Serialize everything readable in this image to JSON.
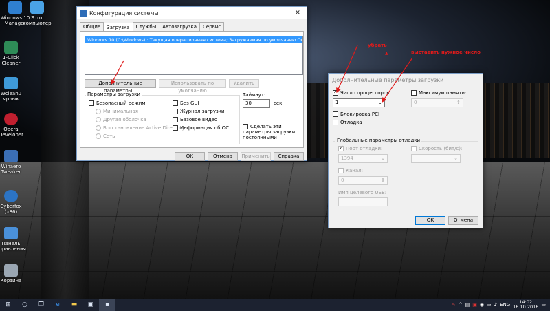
{
  "desktop_icons": [
    {
      "label_line1": "Windows 10",
      "label_line2": "Manager",
      "color": "#2f7fd0"
    },
    {
      "label_line1": "Этот",
      "label_line2": "компьютер",
      "color": "#4aa3e6"
    },
    {
      "label_line1": "1-Click",
      "label_line2": "Cleaner",
      "color": "#2e8b57"
    },
    {
      "label_line1": "Wcleanu",
      "label_line2": "ярлык",
      "color": "#3f9ad8"
    },
    {
      "label_line1": "Opera",
      "label_line2": "Developer",
      "color": "#c01f2f"
    },
    {
      "label_line1": "Winaero",
      "label_line2": "Tweaker",
      "color": "#3b6fb6"
    },
    {
      "label_line1": "Cyberfox",
      "label_line2": "(x86)",
      "color": "#2c74c5"
    },
    {
      "label_line1": "Панель",
      "label_line2": "управления",
      "color": "#4a90d9"
    },
    {
      "label_line1": "Корзина",
      "label_line2": "",
      "color": "#9aa6b2"
    }
  ],
  "msconfig": {
    "title": "Конфигурация системы",
    "close": "✕",
    "tabs": [
      "Общие",
      "Загрузка",
      "Службы",
      "Автозагрузка",
      "Сервис"
    ],
    "active_tab": "Загрузка",
    "boot_entry": "Windows 10 (C:\\Windows) : Текущая операционная система; Загружаемая по умолчанию ОС",
    "advanced_button": "Дополнительные параметры...",
    "set_default_button": "Использовать по умолчанию",
    "delete_button": "Удалить",
    "boot_options_label": "Параметры загрузки",
    "safe_mode": "Безопасный режим",
    "minimal": "Минимальная",
    "alt_shell": "Другая оболочка",
    "ad_restore": "Восстановление Active Directory",
    "network": "Сеть",
    "no_gui": "Без GUI",
    "boot_log": "Журнал загрузки",
    "base_video": "Базовое видео",
    "os_info": "Информация об ОС",
    "timeout_label": "Таймаут:",
    "timeout_value": "30",
    "timeout_unit": "сек.",
    "make_permanent": "Сделать эти параметры загрузки постоянными",
    "ok": "ОК",
    "cancel": "Отмена",
    "apply": "Применить",
    "help": "Справка"
  },
  "advanced": {
    "title": "Дополнительные параметры загрузки",
    "num_processors_label": "Число процессоров:",
    "num_processors_value": "1",
    "max_memory_label": "Максимум памяти:",
    "max_memory_value": "0",
    "pci_lock": "Блокировка PCI",
    "debug": "Отладка",
    "global_debug_label": "Глобальные параметры отладки",
    "debug_port_label": "Порт отладки:",
    "debug_port_value": "1394",
    "baud_rate_label": "Скорость (бит/с):",
    "channel_label": "Канал:",
    "channel_value": "0",
    "usb_target_label": "Имя целевого USB:",
    "ok": "ОК",
    "cancel": "Отмена"
  },
  "annotations": {
    "remove": "убрать",
    "set_number": "выставить нужное число",
    "color": "#e01b1b"
  },
  "taskbar": {
    "lang": "ENG",
    "time": "14:02",
    "date": "16.10.2016"
  }
}
